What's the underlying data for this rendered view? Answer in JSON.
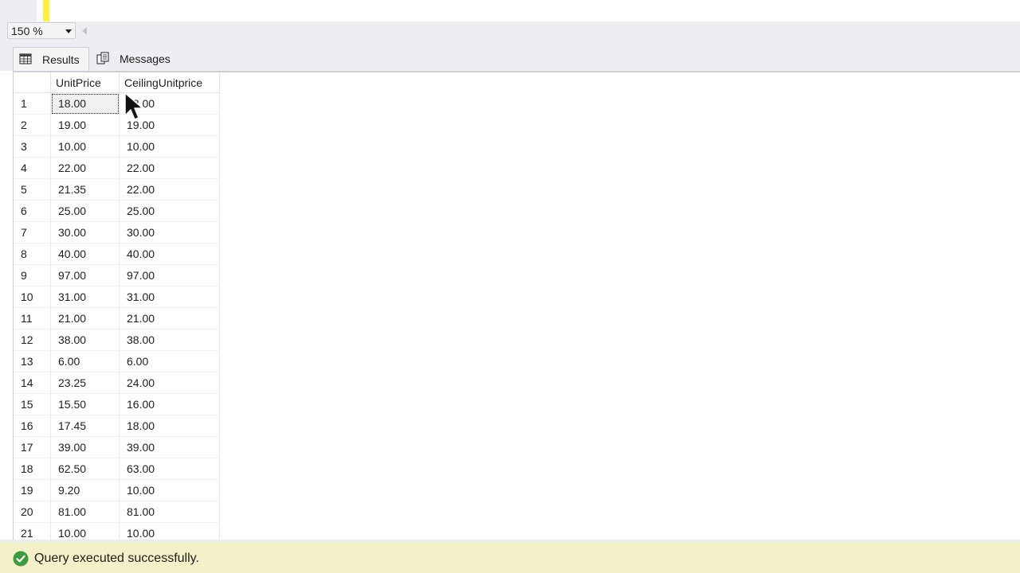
{
  "toolbar": {
    "zoom_value": "150 %"
  },
  "tabs": [
    {
      "label": "Results",
      "icon": "grid-icon",
      "active": true
    },
    {
      "label": "Messages",
      "icon": "messages-icon",
      "active": false
    }
  ],
  "grid": {
    "columns": [
      "",
      "UnitPrice",
      "CeilingUnitprice"
    ],
    "rows": [
      [
        "1",
        "18.00",
        "18.00"
      ],
      [
        "2",
        "19.00",
        "19.00"
      ],
      [
        "3",
        "10.00",
        "10.00"
      ],
      [
        "4",
        "22.00",
        "22.00"
      ],
      [
        "5",
        "21.35",
        "22.00"
      ],
      [
        "6",
        "25.00",
        "25.00"
      ],
      [
        "7",
        "30.00",
        "30.00"
      ],
      [
        "8",
        "40.00",
        "40.00"
      ],
      [
        "9",
        "97.00",
        "97.00"
      ],
      [
        "10",
        "31.00",
        "31.00"
      ],
      [
        "11",
        "21.00",
        "21.00"
      ],
      [
        "12",
        "38.00",
        "38.00"
      ],
      [
        "13",
        "6.00",
        "6.00"
      ],
      [
        "14",
        "23.25",
        "24.00"
      ],
      [
        "15",
        "15.50",
        "16.00"
      ],
      [
        "16",
        "17.45",
        "18.00"
      ],
      [
        "17",
        "39.00",
        "39.00"
      ],
      [
        "18",
        "62.50",
        "63.00"
      ],
      [
        "19",
        "9.20",
        "10.00"
      ],
      [
        "20",
        "81.00",
        "81.00"
      ],
      [
        "21",
        "10.00",
        "10.00"
      ]
    ]
  },
  "status": {
    "text": "Query executed successfully.",
    "icon": "check-circle-icon",
    "color": "#3a9c3e",
    "bar_color": "#f4f1c8"
  }
}
